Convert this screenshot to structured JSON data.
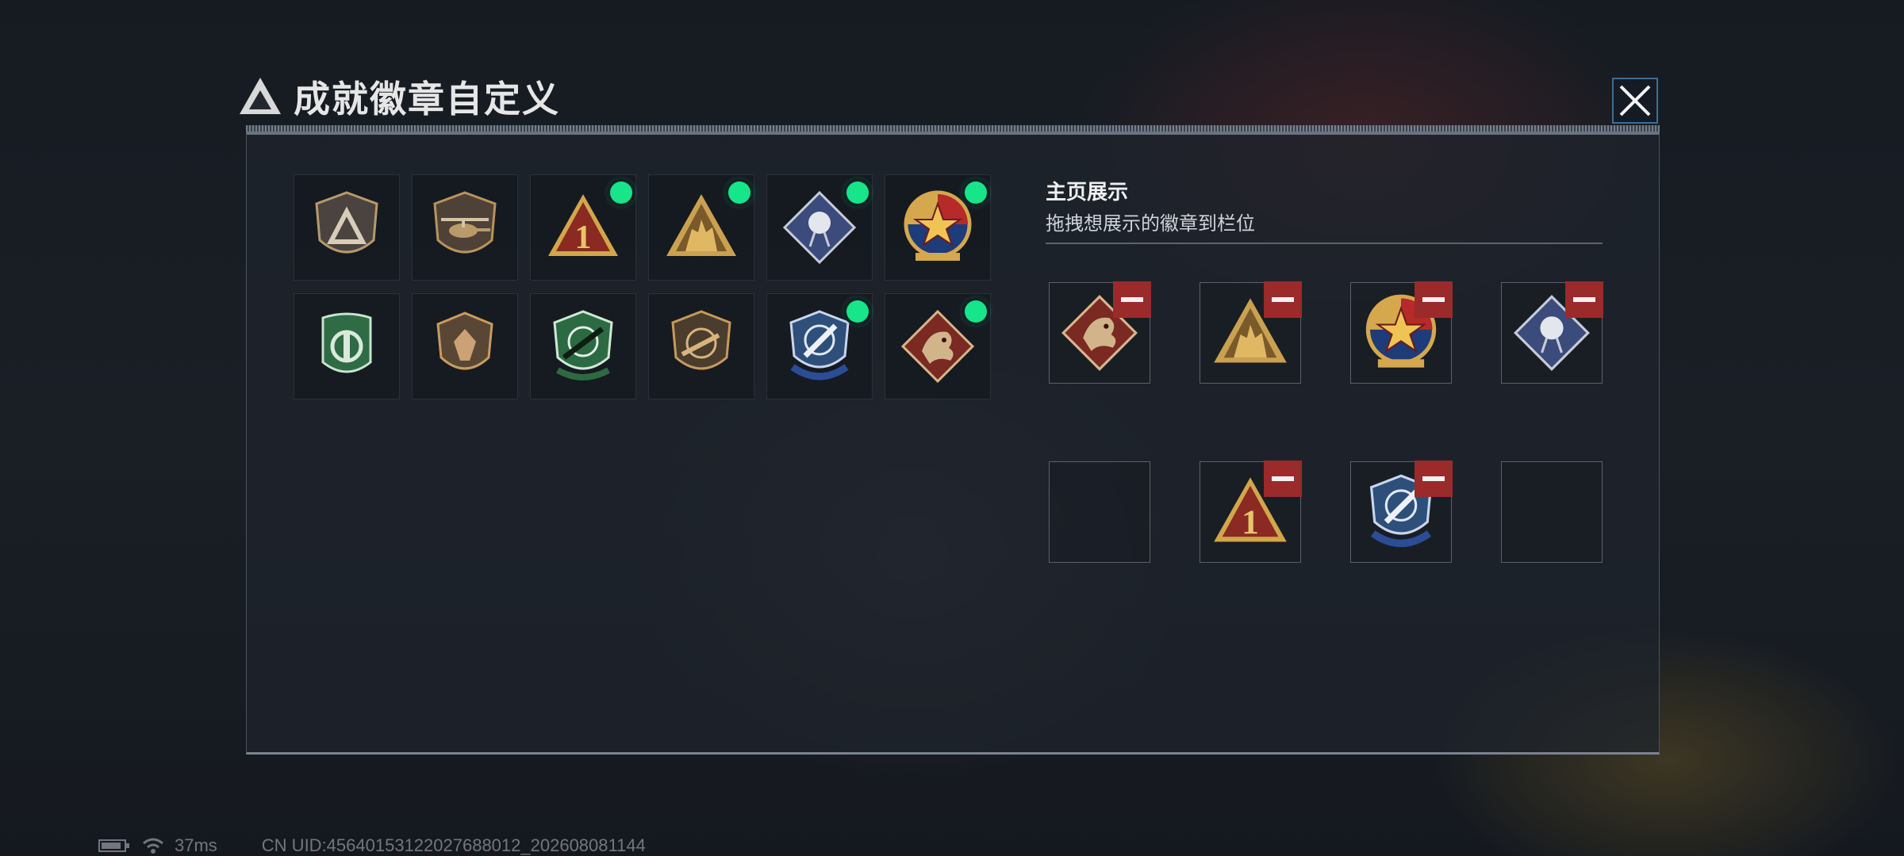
{
  "header": {
    "title": "成就徽章自定义"
  },
  "badge_library": [
    {
      "name": "delta-shield",
      "equipped": false
    },
    {
      "name": "helicopter",
      "equipped": false
    },
    {
      "name": "number-one-triangle",
      "equipped": true
    },
    {
      "name": "soldiers-triangle",
      "equipped": true
    },
    {
      "name": "rose-diamond",
      "equipped": true
    },
    {
      "name": "star-eagle-medal",
      "equipped": true
    },
    {
      "name": "green-crest",
      "equipped": false
    },
    {
      "name": "bronze-shield",
      "equipped": false
    },
    {
      "name": "green-rifle-shield",
      "equipped": false
    },
    {
      "name": "bronze-rifle-shield",
      "equipped": false
    },
    {
      "name": "blue-knife-shield",
      "equipped": true
    },
    {
      "name": "dragon-diamond",
      "equipped": true
    }
  ],
  "display": {
    "title": "主页展示",
    "subtitle": "拖拽想展示的徽章到栏位",
    "slots": [
      {
        "badge": "dragon-diamond"
      },
      {
        "badge": "soldiers-triangle"
      },
      {
        "badge": "star-eagle-medal"
      },
      {
        "badge": "rose-diamond"
      },
      {
        "badge": ""
      },
      {
        "badge": "number-one-triangle"
      },
      {
        "badge": "blue-knife-shield"
      },
      {
        "badge": ""
      }
    ]
  },
  "status": {
    "ping": "37ms",
    "uid": "CN UID:4564015312202768801​2_202608081144"
  },
  "colors": {
    "accent_green": "#17e58a",
    "remove_red": "#9b2a2b",
    "gold": "#c9a24c"
  }
}
